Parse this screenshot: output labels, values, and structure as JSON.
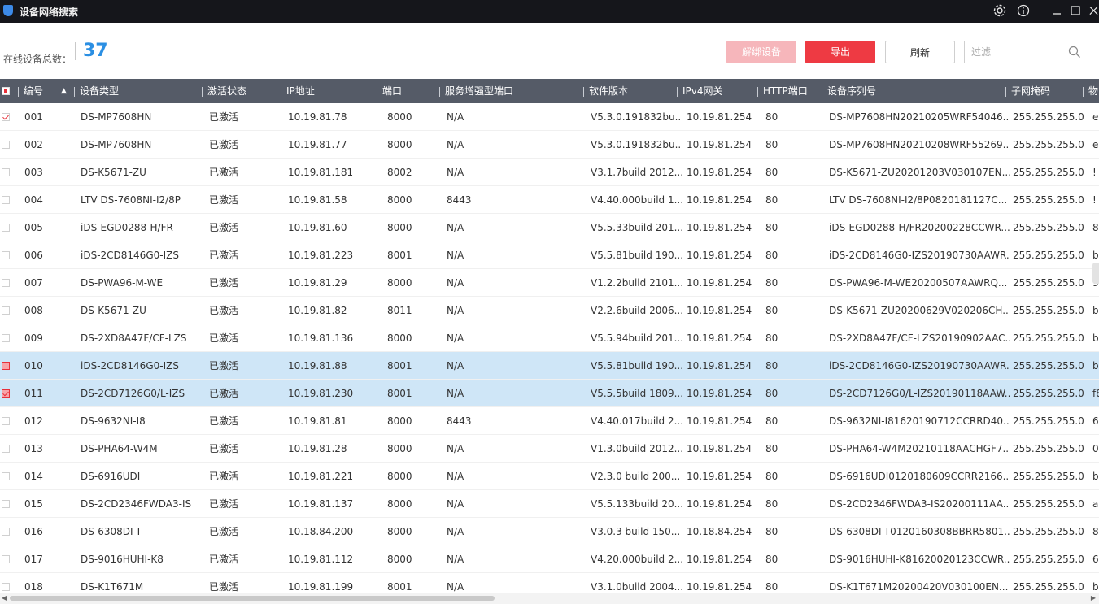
{
  "window": {
    "title": "设备网络搜索",
    "icons": [
      "settings-icon",
      "info-icon",
      "minimize-icon",
      "maximize-icon",
      "close-icon"
    ]
  },
  "toolbar": {
    "total_label": "在线设备总数：",
    "total_count": "37",
    "unbind_label": "解绑设备",
    "export_label": "导出",
    "refresh_label": "刷新",
    "filter_placeholder": "过滤"
  },
  "colors": {
    "accent": "#2b8fe3",
    "export": "#ee3a43",
    "unbind_disabled": "#f6b6bb",
    "header_bg": "#555b67",
    "selected_row": "#cfe6f7"
  },
  "table": {
    "columns": [
      "编号",
      "设备类型",
      "激活状态",
      "IP地址",
      "端口",
      "服务增强型端口",
      "软件版本",
      "IPv4网关",
      "HTTP端口",
      "设备序列号",
      "子网掩码",
      "物"
    ],
    "rows": [
      {
        "checked": true,
        "selected": false,
        "id": "001",
        "type": "DS-MP7608HN",
        "status": "已激活",
        "ip": "10.19.81.78",
        "port": "8000",
        "sport": "N/A",
        "sw": "V5.3.0.191832bu...",
        "gw": "10.19.81.254",
        "http": "80",
        "sn": "DS-MP7608HN20210205WRF54046...",
        "mask": "255.255.255.0",
        "mac": "e"
      },
      {
        "checked": false,
        "selected": false,
        "id": "002",
        "type": "DS-MP7608HN",
        "status": "已激活",
        "ip": "10.19.81.77",
        "port": "8000",
        "sport": "N/A",
        "sw": "V5.3.0.191832bu...",
        "gw": "10.19.81.254",
        "http": "80",
        "sn": "DS-MP7608HN20210208WRF55269...",
        "mask": "255.255.255.0",
        "mac": "e"
      },
      {
        "checked": false,
        "selected": false,
        "id": "003",
        "type": "DS-K5671-ZU",
        "status": "已激活",
        "ip": "10.19.81.181",
        "port": "8002",
        "sport": "N/A",
        "sw": "V3.1.7build 2012...",
        "gw": "10.19.81.254",
        "http": "80",
        "sn": "DS-K5671-ZU20201203V030107EN...",
        "mask": "255.255.255.0",
        "mac": "!"
      },
      {
        "checked": false,
        "selected": false,
        "id": "004",
        "type": "LTV DS-7608NI-I2/8P",
        "status": "已激活",
        "ip": "10.19.81.58",
        "port": "8000",
        "sport": "8443",
        "sw": "V4.40.000build 1...",
        "gw": "10.19.81.254",
        "http": "80",
        "sn": "LTV DS-7608NI-I2/8P0820181127C...",
        "mask": "255.255.255.0",
        "mac": "!"
      },
      {
        "checked": false,
        "selected": false,
        "id": "005",
        "type": "iDS-EGD0288-H/FR",
        "status": "已激活",
        "ip": "10.19.81.60",
        "port": "8000",
        "sport": "N/A",
        "sw": "V5.5.33build 201...",
        "gw": "10.19.81.254",
        "http": "80",
        "sn": "iDS-EGD0288-H/FR20200228CCWR...",
        "mask": "255.255.255.0",
        "mac": "8"
      },
      {
        "checked": false,
        "selected": false,
        "id": "006",
        "type": "iDS-2CD8146G0-IZS",
        "status": "已激活",
        "ip": "10.19.81.223",
        "port": "8001",
        "sport": "N/A",
        "sw": "V5.5.81build 190...",
        "gw": "10.19.81.254",
        "http": "80",
        "sn": "iDS-2CD8146G0-IZS20190730AAWR...",
        "mask": "255.255.255.0",
        "mac": "b"
      },
      {
        "checked": false,
        "selected": false,
        "id": "007",
        "type": "DS-PWA96-M-WE",
        "status": "已激活",
        "ip": "10.19.81.29",
        "port": "8000",
        "sport": "N/A",
        "sw": "V1.2.2build 2101...",
        "gw": "10.19.81.254",
        "http": "80",
        "sn": "DS-PWA96-M-WE20200507AAWRQ...",
        "mask": "255.255.255.0",
        "mac": "9"
      },
      {
        "checked": false,
        "selected": false,
        "id": "008",
        "type": "DS-K5671-ZU",
        "status": "已激活",
        "ip": "10.19.81.82",
        "port": "8011",
        "sport": "N/A",
        "sw": "V2.2.6build 2006...",
        "gw": "10.19.81.254",
        "http": "80",
        "sn": "DS-K5671-ZU20200629V020206CH...",
        "mask": "255.255.255.0",
        "mac": "b"
      },
      {
        "checked": false,
        "selected": false,
        "id": "009",
        "type": "DS-2XD8A47F/CF-LZS",
        "status": "已激活",
        "ip": "10.19.81.136",
        "port": "8000",
        "sport": "N/A",
        "sw": "V5.5.94build 201...",
        "gw": "10.19.81.254",
        "http": "80",
        "sn": "DS-2XD8A47F/CF-LZS20190902AAC...",
        "mask": "255.255.255.0",
        "mac": "b"
      },
      {
        "checked": false,
        "selected": true,
        "id": "010",
        "type": "iDS-2CD8146G0-IZS",
        "status": "已激活",
        "ip": "10.19.81.88",
        "port": "8001",
        "sport": "N/A",
        "sw": "V5.5.81build 190...",
        "gw": "10.19.81.254",
        "http": "80",
        "sn": "iDS-2CD8146G0-IZS20190730AAWR...",
        "mask": "255.255.255.0",
        "mac": "b"
      },
      {
        "checked": true,
        "selected": true,
        "id": "011",
        "type": "DS-2CD7126G0/L-IZS",
        "status": "已激活",
        "ip": "10.19.81.230",
        "port": "8001",
        "sport": "N/A",
        "sw": "V5.5.5build 1809...",
        "gw": "10.19.81.254",
        "http": "80",
        "sn": "DS-2CD7126G0/L-IZS20190118AAW...",
        "mask": "255.255.255.0",
        "mac": "f8"
      },
      {
        "checked": false,
        "selected": false,
        "id": "012",
        "type": "DS-9632NI-I8",
        "status": "已激活",
        "ip": "10.19.81.81",
        "port": "8000",
        "sport": "8443",
        "sw": "V4.40.017build 2...",
        "gw": "10.19.81.254",
        "http": "80",
        "sn": "DS-9632NI-I81620190712CCRRD40...",
        "mask": "255.255.255.0",
        "mac": "6"
      },
      {
        "checked": false,
        "selected": false,
        "id": "013",
        "type": "DS-PHA64-W4M",
        "status": "已激活",
        "ip": "10.19.81.28",
        "port": "8000",
        "sport": "N/A",
        "sw": "V1.3.0build 2012...",
        "gw": "10.19.81.254",
        "http": "80",
        "sn": "DS-PHA64-W4M20210118AACHGF7...",
        "mask": "255.255.255.0",
        "mac": "0"
      },
      {
        "checked": false,
        "selected": false,
        "id": "014",
        "type": "DS-6916UDI",
        "status": "已激活",
        "ip": "10.19.81.221",
        "port": "8000",
        "sport": "N/A",
        "sw": "V2.3.0 build 200...",
        "gw": "10.19.81.254",
        "http": "80",
        "sn": "DS-6916UDI0120180609CCRR2166...",
        "mask": "255.255.255.0",
        "mac": "b"
      },
      {
        "checked": false,
        "selected": false,
        "id": "015",
        "type": "DS-2CD2346FWDA3-IS",
        "status": "已激活",
        "ip": "10.19.81.137",
        "port": "8000",
        "sport": "N/A",
        "sw": "V5.5.133build 20...",
        "gw": "10.19.81.254",
        "http": "80",
        "sn": "DS-2CD2346FWDA3-IS20200111AA...",
        "mask": "255.255.255.0",
        "mac": "a"
      },
      {
        "checked": false,
        "selected": false,
        "id": "016",
        "type": "DS-6308DI-T",
        "status": "已激活",
        "ip": "10.18.84.200",
        "port": "8000",
        "sport": "N/A",
        "sw": "V3.0.3 build 150...",
        "gw": "10.18.84.254",
        "http": "80",
        "sn": "DS-6308DI-T0120160308BBRR5801...",
        "mask": "255.255.255.0",
        "mac": "8"
      },
      {
        "checked": false,
        "selected": false,
        "id": "017",
        "type": "DS-9016HUHI-K8",
        "status": "已激活",
        "ip": "10.19.81.112",
        "port": "8000",
        "sport": "N/A",
        "sw": "V4.20.000build 2...",
        "gw": "10.19.81.254",
        "http": "80",
        "sn": "DS-9016HUHI-K81620020123CCWR...",
        "mask": "255.255.255.0",
        "mac": "6"
      },
      {
        "checked": false,
        "selected": false,
        "id": "018",
        "type": "DS-K1T671M",
        "status": "已激活",
        "ip": "10.19.81.199",
        "port": "8001",
        "sport": "N/A",
        "sw": "V3.1.0build 2004...",
        "gw": "10.19.81.254",
        "http": "80",
        "sn": "DS-K1T671M20200420V030100EN...",
        "mask": "255.255.255.0",
        "mac": "b"
      }
    ]
  }
}
